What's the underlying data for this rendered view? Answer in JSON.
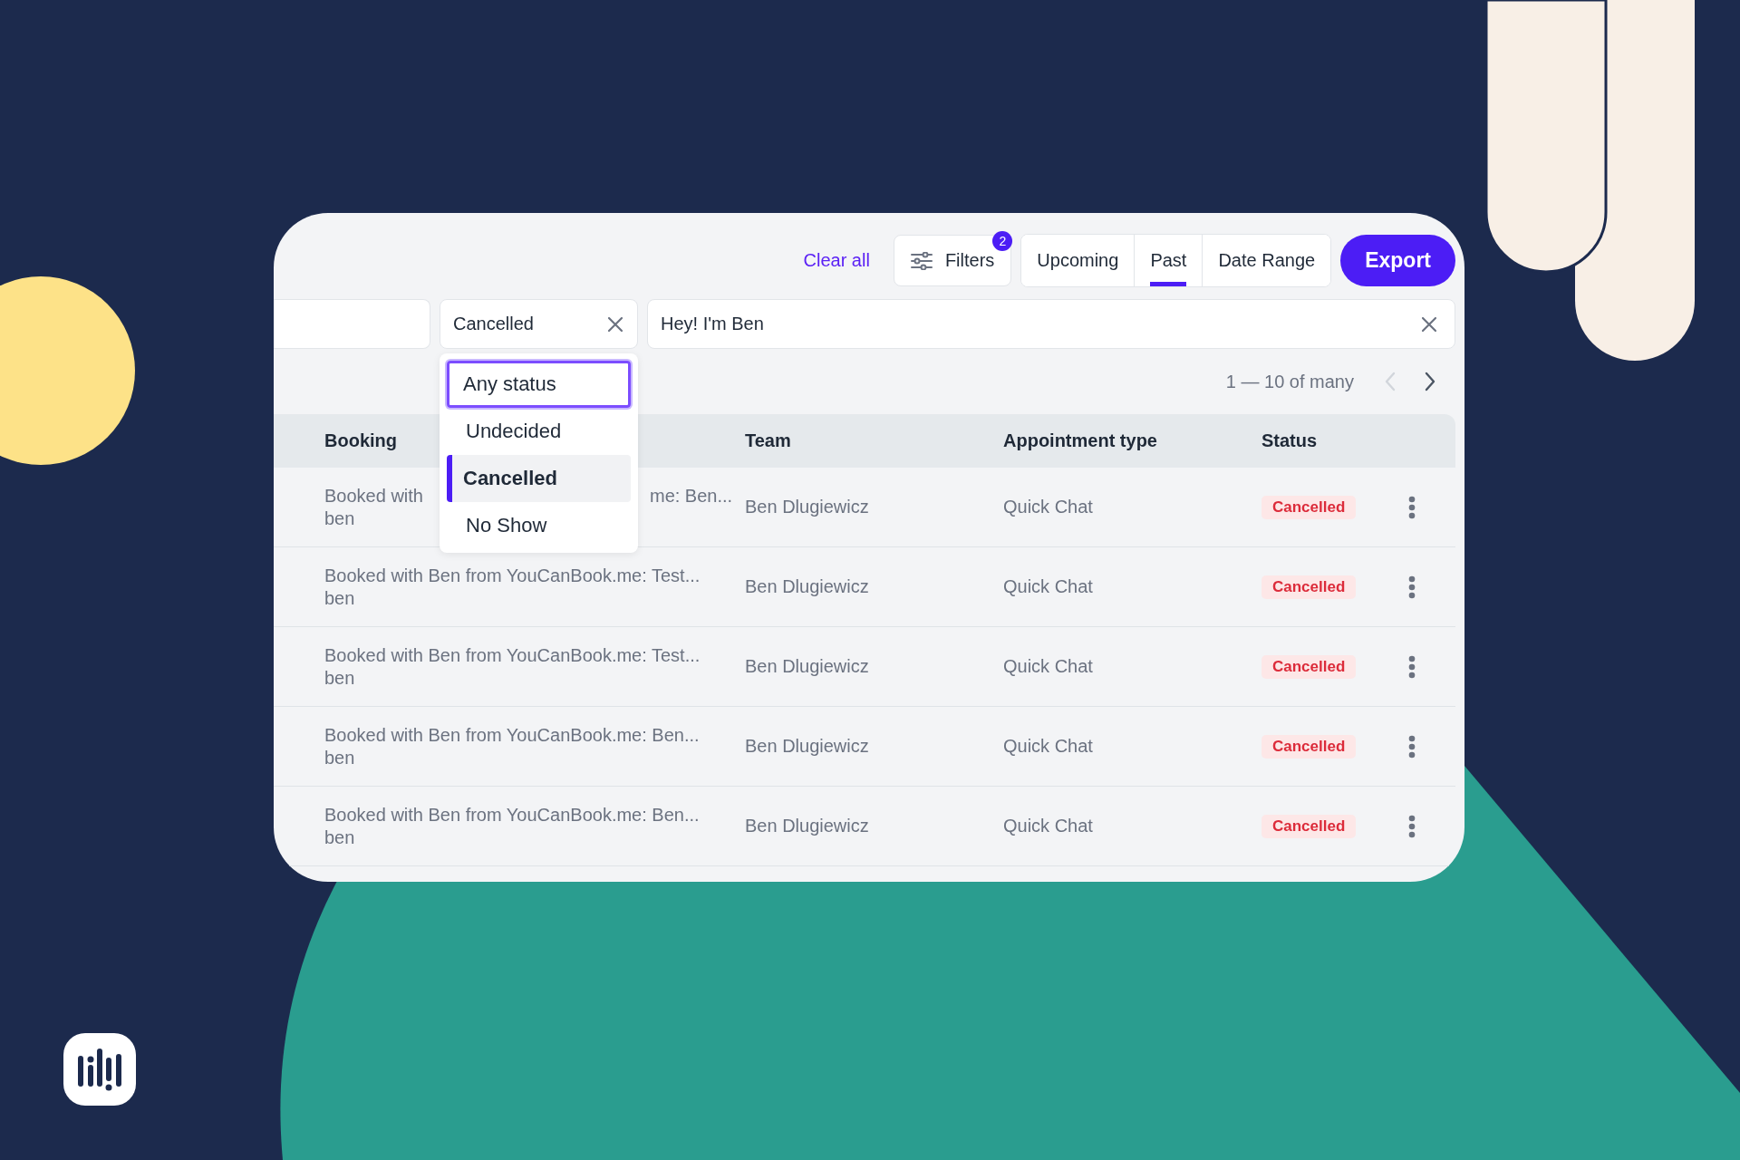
{
  "toolbar": {
    "clear_all": "Clear all",
    "filters": {
      "label": "Filters",
      "badge": "2"
    },
    "tabs": [
      {
        "label": "Upcoming",
        "selected": false
      },
      {
        "label": "Past",
        "selected": true
      },
      {
        "label": "Date Range",
        "selected": false
      }
    ],
    "export": "Export"
  },
  "filter_fields": {
    "status": {
      "value": "Cancelled"
    },
    "search": {
      "value": "Hey! I'm Ben"
    }
  },
  "status_menu": [
    {
      "label": "Any status",
      "focused": true,
      "selected": false
    },
    {
      "label": "Undecided",
      "focused": false,
      "selected": false
    },
    {
      "label": "Cancelled",
      "focused": false,
      "selected": true
    },
    {
      "label": "No Show",
      "focused": false,
      "selected": false
    }
  ],
  "pagination": {
    "range": "1 — 10 of many",
    "prev_disabled": true,
    "next_disabled": false
  },
  "table": {
    "columns": [
      "Booking",
      "Team",
      "Appointment type",
      "Status"
    ],
    "rows": [
      {
        "booking": "Booked with",
        "booking_end": "me: Ben...",
        "guest": "ben",
        "team": "Ben Dlugiewicz",
        "type": "Quick Chat",
        "status": "Cancelled"
      },
      {
        "booking": "Booked with Ben from YouCanBook.me: Test...",
        "guest": "ben",
        "team": "Ben Dlugiewicz",
        "type": "Quick Chat",
        "status": "Cancelled"
      },
      {
        "booking": "Booked with Ben from YouCanBook.me: Test...",
        "guest": "ben",
        "team": "Ben Dlugiewicz",
        "type": "Quick Chat",
        "status": "Cancelled"
      },
      {
        "booking": "Booked with Ben from YouCanBook.me: Ben...",
        "guest": "ben",
        "team": "Ben Dlugiewicz",
        "type": "Quick Chat",
        "status": "Cancelled"
      },
      {
        "booking": "Booked with Ben from YouCanBook.me: Ben...",
        "guest": "ben",
        "team": "Ben Dlugiewicz",
        "type": "Quick Chat",
        "status": "Cancelled"
      }
    ]
  }
}
